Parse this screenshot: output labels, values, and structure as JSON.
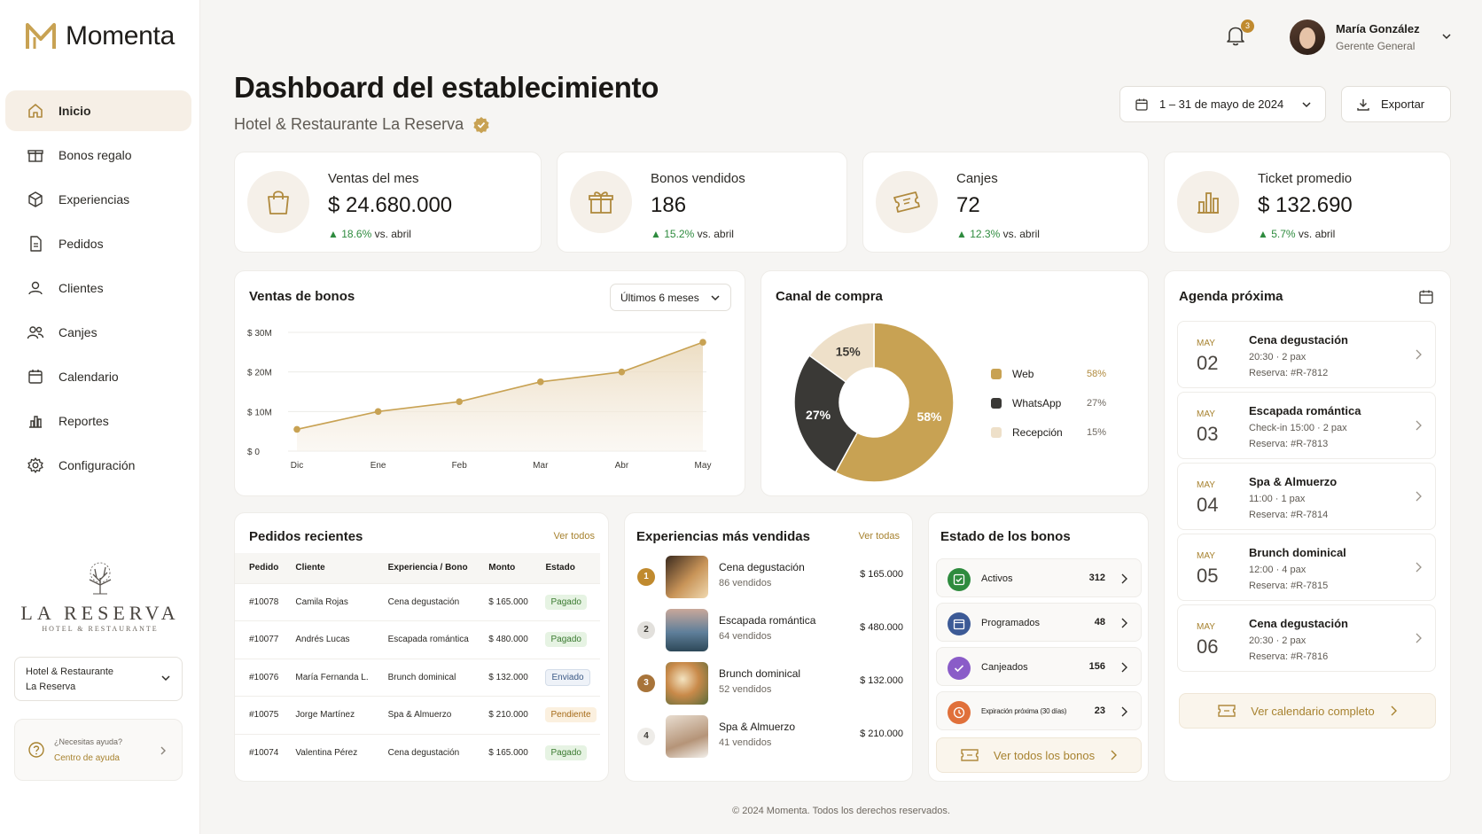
{
  "app": {
    "name": "Momenta",
    "brand_color": "#c8a253"
  },
  "sidebar": {
    "items": [
      {
        "label": "Inicio",
        "icon": "home-icon"
      },
      {
        "label": "Bonos regalo",
        "icon": "gift-icon"
      },
      {
        "label": "Experiencias",
        "icon": "box-icon"
      },
      {
        "label": "Pedidos",
        "icon": "file-icon"
      },
      {
        "label": "Clientes",
        "icon": "user-icon"
      },
      {
        "label": "Canjes",
        "icon": "users-icon"
      },
      {
        "label": "Calendario",
        "icon": "calendar-icon"
      },
      {
        "label": "Reportes",
        "icon": "bar-chart-icon"
      },
      {
        "label": "Configuración",
        "icon": "gear-icon"
      }
    ],
    "brand": {
      "name": "LA RESERVA",
      "subtitle": "HOTEL & RESTAURANTE"
    },
    "establishment": {
      "line1": "Hotel & Restaurante",
      "line2": "La Reserva"
    },
    "help": {
      "question": "¿Necesitas ayuda?",
      "link": "Centro de ayuda"
    }
  },
  "header": {
    "notifications": "3",
    "user_name": "María González",
    "user_role": "Gerente General",
    "title": "Dashboard del establecimiento",
    "subtitle": "Hotel & Restaurante La Reserva",
    "date_range": "1 – 31 de mayo de 2024",
    "export": "Exportar"
  },
  "kpis": [
    {
      "label": "Ventas del mes",
      "value": "$ 24.680.000",
      "delta": "18.6%",
      "compare": " vs. abril"
    },
    {
      "label": "Bonos vendidos",
      "value": "186",
      "delta": "15.2%",
      "compare": " vs. abril"
    },
    {
      "label": "Canjes",
      "value": "72",
      "delta": "12.3%",
      "compare": " vs. abril"
    },
    {
      "label": "Ticket promedio",
      "value": "$ 132.690",
      "delta": "5.7%",
      "compare": " vs. abril"
    }
  ],
  "sales_chart": {
    "title": "Ventas de bonos",
    "period": "Últimos 6 meses"
  },
  "chart_data": [
    {
      "type": "area",
      "categories": [
        "Dic",
        "Ene",
        "Feb",
        "Mar",
        "Abr",
        "May"
      ],
      "values": [
        5.5,
        10,
        12.5,
        17.5,
        20,
        27.5
      ],
      "unit": "millions",
      "yticks": [
        "$ 0",
        "$ 10M",
        "$ 20M",
        "$ 30M"
      ],
      "ylim": [
        0,
        30
      ],
      "color": "#c8a253"
    },
    {
      "type": "pie",
      "title": "Canal de compra",
      "labels": [
        "Web",
        "WhatsApp",
        "Recepción"
      ],
      "values": [
        58,
        27,
        15
      ],
      "display": [
        "58%",
        "27%",
        "15%"
      ],
      "colors": [
        "#c8a253",
        "#3a3936",
        "#eee0c9"
      ]
    }
  ],
  "agenda": {
    "title": "Agenda próxima",
    "items": [
      {
        "month": "MAY",
        "day": "02",
        "title": "Cena degustación",
        "detail": "20:30  ·  2 pax",
        "ref": "Reserva:   #R-7812"
      },
      {
        "month": "MAY",
        "day": "03",
        "title": "Escapada romántica",
        "detail": "Check-in 15:00  ·  2 pax",
        "ref": "Reserva:   #R-7813"
      },
      {
        "month": "MAY",
        "day": "04",
        "title": "Spa & Almuerzo",
        "detail": "11:00  ·  1 pax",
        "ref": "Reserva:   #R-7814"
      },
      {
        "month": "MAY",
        "day": "05",
        "title": "Brunch dominical",
        "detail": "12:00  ·  4 pax",
        "ref": "Reserva:   #R-7815"
      },
      {
        "month": "MAY",
        "day": "06",
        "title": "Cena degustación",
        "detail": "20:30  ·  2 pax",
        "ref": "Reserva:   #R-7816"
      }
    ],
    "cta": "Ver calendario completo"
  },
  "orders": {
    "title": "Pedidos recientes",
    "link": "Ver todos",
    "columns": [
      "Pedido",
      "Cliente",
      "Experiencia / Bono",
      "Monto",
      "Estado"
    ],
    "rows": [
      [
        "#10078",
        "Camila Rojas",
        "Cena degustación",
        "$ 165.000",
        "Pagado"
      ],
      [
        "#10077",
        "Andrés Lucas",
        "Escapada romántica",
        "$ 480.000",
        "Pagado"
      ],
      [
        "#10076",
        "María Fernanda L.",
        "Brunch dominical",
        "$ 132.000",
        "Enviado"
      ],
      [
        "#10075",
        "Jorge Martínez",
        "Spa & Almuerzo",
        "$ 210.000",
        "Pendiente"
      ],
      [
        "#10074",
        "Valentina Pérez",
        "Cena degustación",
        "$ 165.000",
        "Pagado"
      ]
    ]
  },
  "top_experiences": {
    "title": "Experiencias más vendidas",
    "link": "Ver todas",
    "items": [
      {
        "rank": "1",
        "name": "Cena degustación",
        "sold": "86 vendidos",
        "amount": "$ 165.000"
      },
      {
        "rank": "2",
        "name": "Escapada romántica",
        "sold": "64 vendidos",
        "amount": "$ 480.000"
      },
      {
        "rank": "3",
        "name": "Brunch dominical",
        "sold": "52 vendidos",
        "amount": "$ 132.000"
      },
      {
        "rank": "4",
        "name": "Spa & Almuerzo",
        "sold": "41 vendidos",
        "amount": "$ 210.000"
      }
    ]
  },
  "voucher_status": {
    "title": "Estado de los bonos",
    "items": [
      {
        "label": "Activos",
        "count": "312",
        "color": "#2e8b3e"
      },
      {
        "label": "Programados",
        "count": "48",
        "color": "#3c5a96"
      },
      {
        "label": "Canjeados",
        "count": "156",
        "color": "#8a5cc8"
      },
      {
        "label": "Expiración próxima (30 días)",
        "count": "23",
        "color": "#e0703a"
      }
    ],
    "cta": "Ver todos los bonos"
  },
  "footer": "© 2024 Momenta. Todos los derechos reservados."
}
